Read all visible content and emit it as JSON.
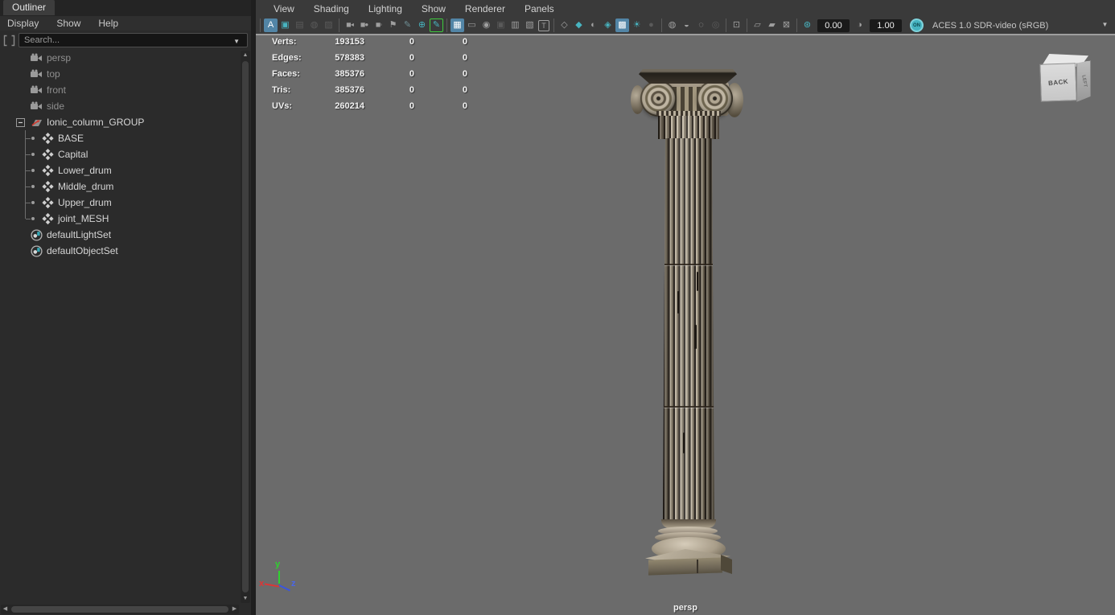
{
  "outliner": {
    "title": "Outliner",
    "menus": [
      "Display",
      "Show",
      "Help"
    ],
    "search_placeholder": "Search...",
    "tree": [
      {
        "label": "persp",
        "icon": "camera",
        "dim": true
      },
      {
        "label": "top",
        "icon": "camera",
        "dim": true
      },
      {
        "label": "front",
        "icon": "camera",
        "dim": true
      },
      {
        "label": "side",
        "icon": "camera",
        "dim": true
      },
      {
        "label": "Ionic_column_GROUP",
        "icon": "transform",
        "expand": true
      },
      {
        "label": "BASE",
        "icon": "mesh",
        "child": true
      },
      {
        "label": "Capital",
        "icon": "mesh",
        "child": true
      },
      {
        "label": "Lower_drum",
        "icon": "mesh",
        "child": true
      },
      {
        "label": "Middle_drum",
        "icon": "mesh",
        "child": true
      },
      {
        "label": "Upper_drum",
        "icon": "mesh",
        "child": true
      },
      {
        "label": "joint_MESH",
        "icon": "mesh",
        "child": true,
        "last": true
      },
      {
        "label": "defaultLightSet",
        "icon": "set"
      },
      {
        "label": "defaultObjectSet",
        "icon": "set"
      }
    ]
  },
  "viewport": {
    "menus": [
      "View",
      "Shading",
      "Lighting",
      "Show",
      "Renderer",
      "Panels"
    ],
    "stats": {
      "rows": [
        {
          "label": "Verts:",
          "values": [
            "193153",
            "0",
            "0"
          ]
        },
        {
          "label": "Edges:",
          "values": [
            "578383",
            "0",
            "0"
          ]
        },
        {
          "label": "Faces:",
          "values": [
            "385376",
            "0",
            "0"
          ]
        },
        {
          "label": "Tris:",
          "values": [
            "385376",
            "0",
            "0"
          ]
        },
        {
          "label": "UVs:",
          "values": [
            "260214",
            "0",
            "0"
          ]
        }
      ]
    },
    "exposure": "0.00",
    "gamma": "1.00",
    "on_badge": "ON",
    "colorspace": "ACES 1.0 SDR-video (sRGB)",
    "camera_label": "persp",
    "viewcube": {
      "front": "BACK",
      "right": "LEFT"
    },
    "axis": {
      "x": "x",
      "y": "y",
      "z": "z"
    },
    "toolbar": [
      {
        "t": "sep"
      },
      {
        "n": "renderer-a-icon",
        "g": "A",
        "s": "blue"
      },
      {
        "n": "frame-selection-icon",
        "g": "▣",
        "s": "teal"
      },
      {
        "n": "image-plane-icon",
        "g": "▤",
        "s": "disabled"
      },
      {
        "n": "sequence-image-icon",
        "g": "◍",
        "s": "disabled"
      },
      {
        "n": "snapshot-icon",
        "g": "▨",
        "s": "disabled"
      },
      {
        "t": "sep"
      },
      {
        "n": "select-camera-icon",
        "g": "◼◂",
        "s": "small2"
      },
      {
        "n": "lock-camera-icon",
        "g": "◼●",
        "s": "small2"
      },
      {
        "n": "camera-attributes-icon",
        "g": "◼◦",
        "s": "small2"
      },
      {
        "n": "bookmarks-icon",
        "g": "⚑"
      },
      {
        "n": "grease-pencil-icon",
        "g": "✎",
        "s": "dim"
      },
      {
        "n": "pan-zoom-icon",
        "g": "⊕",
        "s": "teal"
      },
      {
        "n": "2d-pan-zoom-icon",
        "g": "✎",
        "s": "green"
      },
      {
        "t": "sep"
      },
      {
        "n": "grid-icon",
        "g": "▦",
        "s": "blue"
      },
      {
        "n": "film-gate-icon",
        "g": "▭"
      },
      {
        "n": "resolution-gate-icon",
        "g": "◉"
      },
      {
        "n": "gate-mask-icon",
        "g": "▣",
        "s": "disabled"
      },
      {
        "n": "field-chart-icon",
        "g": "▥"
      },
      {
        "n": "safe-action-icon",
        "g": "▧"
      },
      {
        "n": "safe-title-icon",
        "g": "T",
        "s": "boxed"
      },
      {
        "t": "sep"
      },
      {
        "n": "wireframe-icon",
        "g": "◇"
      },
      {
        "n": "smooth-shade-icon",
        "g": "◆",
        "s": "teal"
      },
      {
        "n": "wireframe-on-shaded-icon",
        "g": "◐"
      },
      {
        "n": "textured-icon",
        "g": "◈",
        "s": "teal"
      },
      {
        "n": "use-default-material-icon",
        "g": "▩",
        "s": "blue"
      },
      {
        "n": "lights-icon",
        "g": "☀",
        "s": "teal"
      },
      {
        "n": "shadows-icon",
        "g": "●",
        "s": "disabled"
      },
      {
        "t": "sep"
      },
      {
        "n": "ssao-icon",
        "g": "◍"
      },
      {
        "n": "motion-blur-icon",
        "g": "◒"
      },
      {
        "n": "anti-aliasing-icon",
        "g": "◌"
      },
      {
        "n": "depth-of-field-icon",
        "g": "◎",
        "s": "disabled"
      },
      {
        "t": "sep"
      },
      {
        "n": "isolate-select-icon",
        "g": "⊡"
      },
      {
        "t": "sep"
      },
      {
        "n": "xray-icon",
        "g": "▱"
      },
      {
        "n": "xray-joints-icon",
        "g": "▰"
      },
      {
        "n": "image-plane-arrow-icon",
        "g": "⊠"
      },
      {
        "t": "sep"
      },
      {
        "n": "exposure-icon",
        "g": "⊛",
        "s": "teal"
      },
      {
        "t": "field",
        "n": "exposure-field",
        "key": "exposure"
      },
      {
        "n": "gamma-icon",
        "g": "◑"
      },
      {
        "t": "field",
        "n": "gamma-field",
        "key": "gamma"
      },
      {
        "t": "badge",
        "n": "colorspace-on-badge",
        "key": "on_badge"
      },
      {
        "t": "label",
        "n": "colorspace-label",
        "key": "colorspace"
      },
      {
        "n": "colorspace-dropdown-arrow",
        "g": "▼",
        "s": "arrow"
      }
    ]
  },
  "colors": {
    "highlight_blue": "#5285a6",
    "teal": "#48b4c0",
    "active_green": "#3ecb3e",
    "viewport_bg": "#6b6b6b"
  }
}
